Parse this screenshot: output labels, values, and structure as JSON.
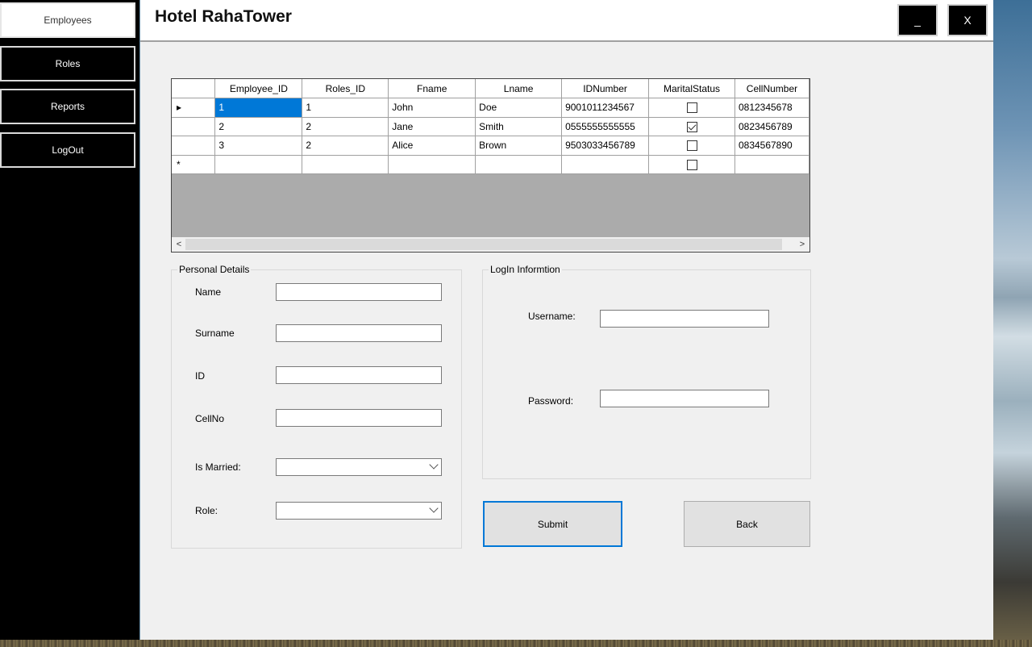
{
  "sidebar": {
    "items": [
      {
        "label": "Employees"
      },
      {
        "label": "Roles"
      },
      {
        "label": "Reports"
      },
      {
        "label": "LogOut"
      }
    ]
  },
  "header": {
    "title": "Hotel RahaTower",
    "minimize_label": "_",
    "close_label": "X"
  },
  "grid": {
    "columns": [
      "Employee_ID",
      "Roles_ID",
      "Fname",
      "Lname",
      "IDNumber",
      "MaritalStatus",
      "CellNumber"
    ],
    "rows": [
      {
        "indicator": "▸",
        "Employee_ID": "1",
        "Roles_ID": "1",
        "Fname": "John",
        "Lname": "Doe",
        "IDNumber": "9001011234567",
        "MaritalStatus": false,
        "CellNumber": "0812345678"
      },
      {
        "indicator": "",
        "Employee_ID": "2",
        "Roles_ID": "2",
        "Fname": "Jane",
        "Lname": "Smith",
        "IDNumber": "0555555555555",
        "MaritalStatus": true,
        "CellNumber": "0823456789"
      },
      {
        "indicator": "",
        "Employee_ID": "3",
        "Roles_ID": "2",
        "Fname": "Alice",
        "Lname": "Brown",
        "IDNumber": "9503033456789",
        "MaritalStatus": false,
        "CellNumber": "0834567890"
      }
    ],
    "new_row_indicator": "*",
    "scroll_left": "<",
    "scroll_right": ">"
  },
  "personal": {
    "title": "Personal Details",
    "name_label": "Name",
    "surname_label": "Surname",
    "id_label": "ID",
    "cell_label": "CellNo",
    "married_label": "Is Married:",
    "role_label": "Role:"
  },
  "login": {
    "title": "LogIn Informtion",
    "username_label": "Username:",
    "password_label": "Password:"
  },
  "actions": {
    "submit_label": "Submit",
    "back_label": "Back"
  }
}
